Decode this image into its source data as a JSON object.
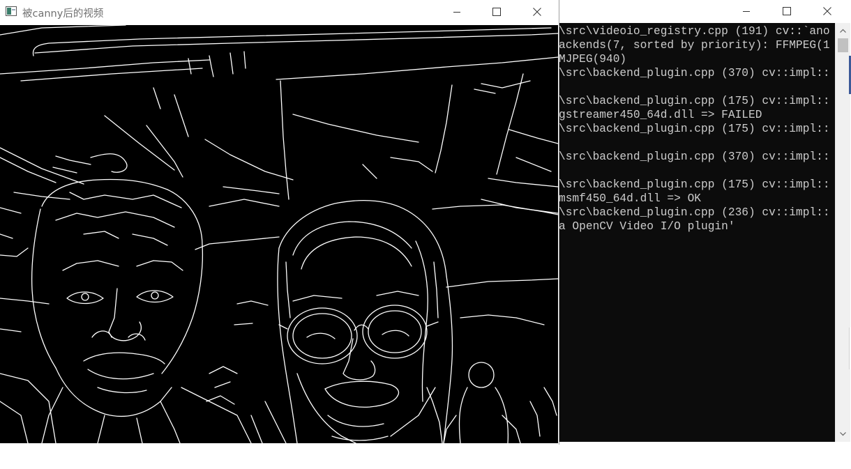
{
  "image_window": {
    "title": "被canny后的视频",
    "canvas_description_icon": "edge-map"
  },
  "console_window": {
    "lines": [
      "\\src\\videoio_registry.cpp (191) cv::`ano",
      "ackends(7, sorted by priority): FFMPEG(1",
      "MJPEG(940)",
      "\\src\\backend_plugin.cpp (370) cv::impl::",
      "",
      "\\src\\backend_plugin.cpp (175) cv::impl::",
      "gstreamer450_64d.dll => FAILED",
      "\\src\\backend_plugin.cpp (175) cv::impl::",
      "",
      "\\src\\backend_plugin.cpp (370) cv::impl::",
      "",
      "\\src\\backend_plugin.cpp (175) cv::impl::",
      "msmf450_64d.dll => OK",
      "\\src\\backend_plugin.cpp (236) cv::impl::",
      "a OpenCV Video I/O plugin'"
    ]
  },
  "colors": {
    "console_bg": "#0c0c0c",
    "console_text": "#cccccc",
    "canvas_bg": "#000000",
    "edges": "#ffffff"
  }
}
